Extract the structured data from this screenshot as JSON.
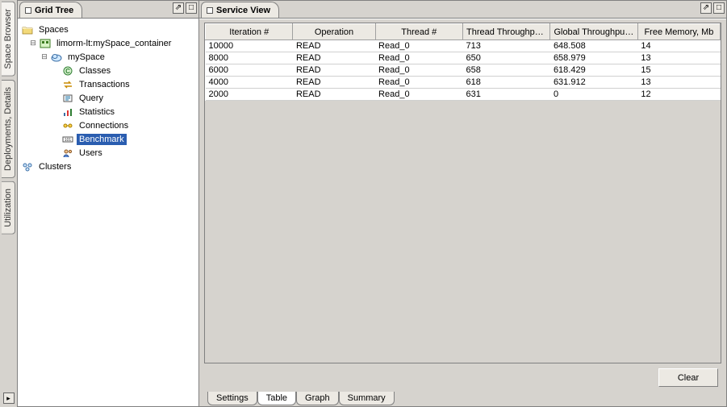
{
  "side_tabs": {
    "space_browser": "Space Browser",
    "deployments_details": "Deployments, Details",
    "utilization": "Utilization"
  },
  "left_panel": {
    "title": "Grid Tree"
  },
  "tree": {
    "root": "Spaces",
    "container": "limorm-lt:mySpace_container",
    "space": "mySpace",
    "nodes": {
      "classes": "Classes",
      "transactions": "Transactions",
      "query": "Query",
      "statistics": "Statistics",
      "connections": "Connections",
      "benchmark": "Benchmark",
      "users": "Users"
    },
    "clusters": "Clusters"
  },
  "right_panel": {
    "title": "Service View"
  },
  "table": {
    "columns": {
      "iteration": "Iteration #",
      "operation": "Operation",
      "thread": "Thread #",
      "thread_tp": "Thread Throughpu...",
      "global_tp": "Global Throughput,...",
      "free_mem": "Free Memory, Mb"
    },
    "rows": [
      {
        "iteration": "10000",
        "operation": "READ",
        "thread": "Read_0",
        "thread_tp": "713",
        "global_tp": "648.508",
        "free_mem": "14"
      },
      {
        "iteration": "8000",
        "operation": "READ",
        "thread": "Read_0",
        "thread_tp": "650",
        "global_tp": "658.979",
        "free_mem": "13"
      },
      {
        "iteration": "6000",
        "operation": "READ",
        "thread": "Read_0",
        "thread_tp": "658",
        "global_tp": "618.429",
        "free_mem": "15"
      },
      {
        "iteration": "4000",
        "operation": "READ",
        "thread": "Read_0",
        "thread_tp": "618",
        "global_tp": "631.912",
        "free_mem": "13"
      },
      {
        "iteration": "2000",
        "operation": "READ",
        "thread": "Read_0",
        "thread_tp": "631",
        "global_tp": "0",
        "free_mem": "12"
      }
    ]
  },
  "buttons": {
    "clear": "Clear"
  },
  "subtabs": {
    "settings": "Settings",
    "table": "Table",
    "graph": "Graph",
    "summary": "Summary"
  }
}
